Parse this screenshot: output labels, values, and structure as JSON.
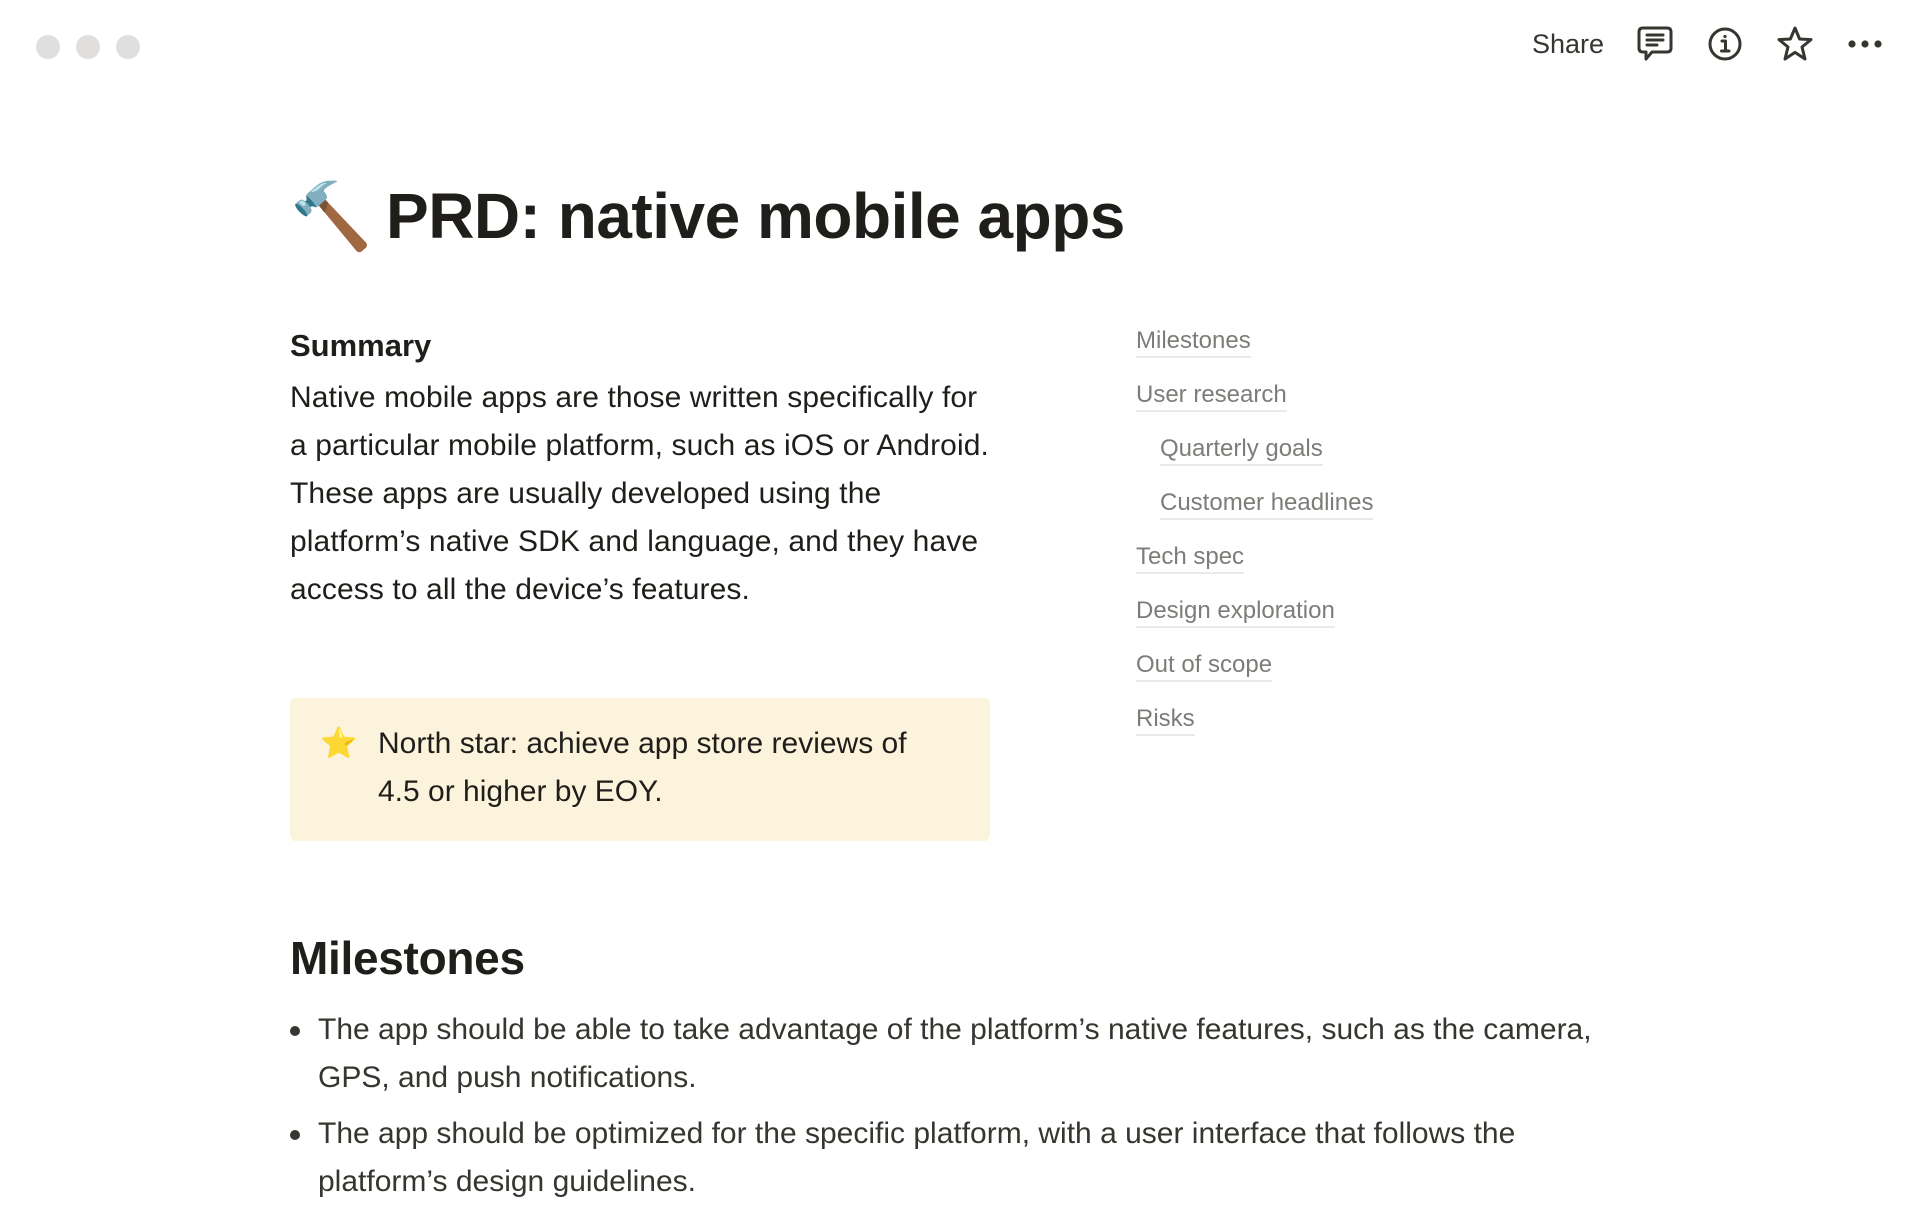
{
  "window": {
    "traffic_lights": [
      "close",
      "minimize",
      "zoom"
    ]
  },
  "topbar": {
    "share_label": "Share",
    "icons": [
      "comment-icon",
      "info-icon",
      "star-icon",
      "more-icon"
    ]
  },
  "page": {
    "icon": "🔨",
    "title": "PRD: native mobile apps"
  },
  "summary": {
    "heading": "Summary",
    "body": "Native mobile apps are those written specifically for a particular mobile platform, such as iOS or Android. These apps are usually developed using the platform’s native SDK and language, and they have access to all the device’s features."
  },
  "callout": {
    "icon": "⭐",
    "text": "North star: achieve app store reviews of 4.5 or higher by EOY.",
    "background": "#fbf3db"
  },
  "toc": {
    "items": [
      {
        "label": "Milestones",
        "level": 0
      },
      {
        "label": "User research",
        "level": 0
      },
      {
        "label": "Quarterly goals",
        "level": 1
      },
      {
        "label": "Customer headlines",
        "level": 1
      },
      {
        "label": "Tech spec",
        "level": 0
      },
      {
        "label": "Design exploration",
        "level": 0
      },
      {
        "label": "Out of scope",
        "level": 0
      },
      {
        "label": "Risks",
        "level": 0
      }
    ]
  },
  "milestones": {
    "heading": "Milestones",
    "bullets": [
      "The app should be able to take advantage of the platform’s native features, such as the camera, GPS, and push notifications.",
      "The app should be optimized for the specific platform, with a user interface that follows the platform’s design guidelines."
    ]
  }
}
